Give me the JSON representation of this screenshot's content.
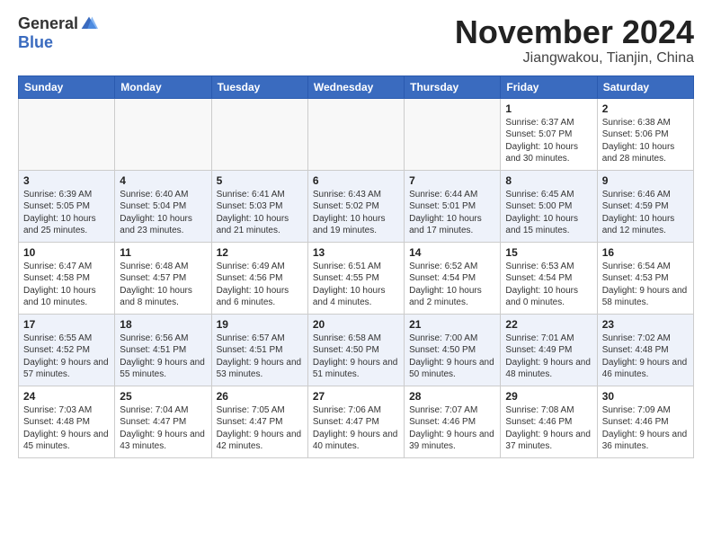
{
  "header": {
    "logo_general": "General",
    "logo_blue": "Blue",
    "month_title": "November 2024",
    "location": "Jiangwakou, Tianjin, China"
  },
  "weekdays": [
    "Sunday",
    "Monday",
    "Tuesday",
    "Wednesday",
    "Thursday",
    "Friday",
    "Saturday"
  ],
  "weeks": [
    [
      {
        "day": "",
        "info": ""
      },
      {
        "day": "",
        "info": ""
      },
      {
        "day": "",
        "info": ""
      },
      {
        "day": "",
        "info": ""
      },
      {
        "day": "",
        "info": ""
      },
      {
        "day": "1",
        "info": "Sunrise: 6:37 AM\nSunset: 5:07 PM\nDaylight: 10 hours and 30 minutes."
      },
      {
        "day": "2",
        "info": "Sunrise: 6:38 AM\nSunset: 5:06 PM\nDaylight: 10 hours and 28 minutes."
      }
    ],
    [
      {
        "day": "3",
        "info": "Sunrise: 6:39 AM\nSunset: 5:05 PM\nDaylight: 10 hours and 25 minutes."
      },
      {
        "day": "4",
        "info": "Sunrise: 6:40 AM\nSunset: 5:04 PM\nDaylight: 10 hours and 23 minutes."
      },
      {
        "day": "5",
        "info": "Sunrise: 6:41 AM\nSunset: 5:03 PM\nDaylight: 10 hours and 21 minutes."
      },
      {
        "day": "6",
        "info": "Sunrise: 6:43 AM\nSunset: 5:02 PM\nDaylight: 10 hours and 19 minutes."
      },
      {
        "day": "7",
        "info": "Sunrise: 6:44 AM\nSunset: 5:01 PM\nDaylight: 10 hours and 17 minutes."
      },
      {
        "day": "8",
        "info": "Sunrise: 6:45 AM\nSunset: 5:00 PM\nDaylight: 10 hours and 15 minutes."
      },
      {
        "day": "9",
        "info": "Sunrise: 6:46 AM\nSunset: 4:59 PM\nDaylight: 10 hours and 12 minutes."
      }
    ],
    [
      {
        "day": "10",
        "info": "Sunrise: 6:47 AM\nSunset: 4:58 PM\nDaylight: 10 hours and 10 minutes."
      },
      {
        "day": "11",
        "info": "Sunrise: 6:48 AM\nSunset: 4:57 PM\nDaylight: 10 hours and 8 minutes."
      },
      {
        "day": "12",
        "info": "Sunrise: 6:49 AM\nSunset: 4:56 PM\nDaylight: 10 hours and 6 minutes."
      },
      {
        "day": "13",
        "info": "Sunrise: 6:51 AM\nSunset: 4:55 PM\nDaylight: 10 hours and 4 minutes."
      },
      {
        "day": "14",
        "info": "Sunrise: 6:52 AM\nSunset: 4:54 PM\nDaylight: 10 hours and 2 minutes."
      },
      {
        "day": "15",
        "info": "Sunrise: 6:53 AM\nSunset: 4:54 PM\nDaylight: 10 hours and 0 minutes."
      },
      {
        "day": "16",
        "info": "Sunrise: 6:54 AM\nSunset: 4:53 PM\nDaylight: 9 hours and 58 minutes."
      }
    ],
    [
      {
        "day": "17",
        "info": "Sunrise: 6:55 AM\nSunset: 4:52 PM\nDaylight: 9 hours and 57 minutes."
      },
      {
        "day": "18",
        "info": "Sunrise: 6:56 AM\nSunset: 4:51 PM\nDaylight: 9 hours and 55 minutes."
      },
      {
        "day": "19",
        "info": "Sunrise: 6:57 AM\nSunset: 4:51 PM\nDaylight: 9 hours and 53 minutes."
      },
      {
        "day": "20",
        "info": "Sunrise: 6:58 AM\nSunset: 4:50 PM\nDaylight: 9 hours and 51 minutes."
      },
      {
        "day": "21",
        "info": "Sunrise: 7:00 AM\nSunset: 4:50 PM\nDaylight: 9 hours and 50 minutes."
      },
      {
        "day": "22",
        "info": "Sunrise: 7:01 AM\nSunset: 4:49 PM\nDaylight: 9 hours and 48 minutes."
      },
      {
        "day": "23",
        "info": "Sunrise: 7:02 AM\nSunset: 4:48 PM\nDaylight: 9 hours and 46 minutes."
      }
    ],
    [
      {
        "day": "24",
        "info": "Sunrise: 7:03 AM\nSunset: 4:48 PM\nDaylight: 9 hours and 45 minutes."
      },
      {
        "day": "25",
        "info": "Sunrise: 7:04 AM\nSunset: 4:47 PM\nDaylight: 9 hours and 43 minutes."
      },
      {
        "day": "26",
        "info": "Sunrise: 7:05 AM\nSunset: 4:47 PM\nDaylight: 9 hours and 42 minutes."
      },
      {
        "day": "27",
        "info": "Sunrise: 7:06 AM\nSunset: 4:47 PM\nDaylight: 9 hours and 40 minutes."
      },
      {
        "day": "28",
        "info": "Sunrise: 7:07 AM\nSunset: 4:46 PM\nDaylight: 9 hours and 39 minutes."
      },
      {
        "day": "29",
        "info": "Sunrise: 7:08 AM\nSunset: 4:46 PM\nDaylight: 9 hours and 37 minutes."
      },
      {
        "day": "30",
        "info": "Sunrise: 7:09 AM\nSunset: 4:46 PM\nDaylight: 9 hours and 36 minutes."
      }
    ]
  ]
}
